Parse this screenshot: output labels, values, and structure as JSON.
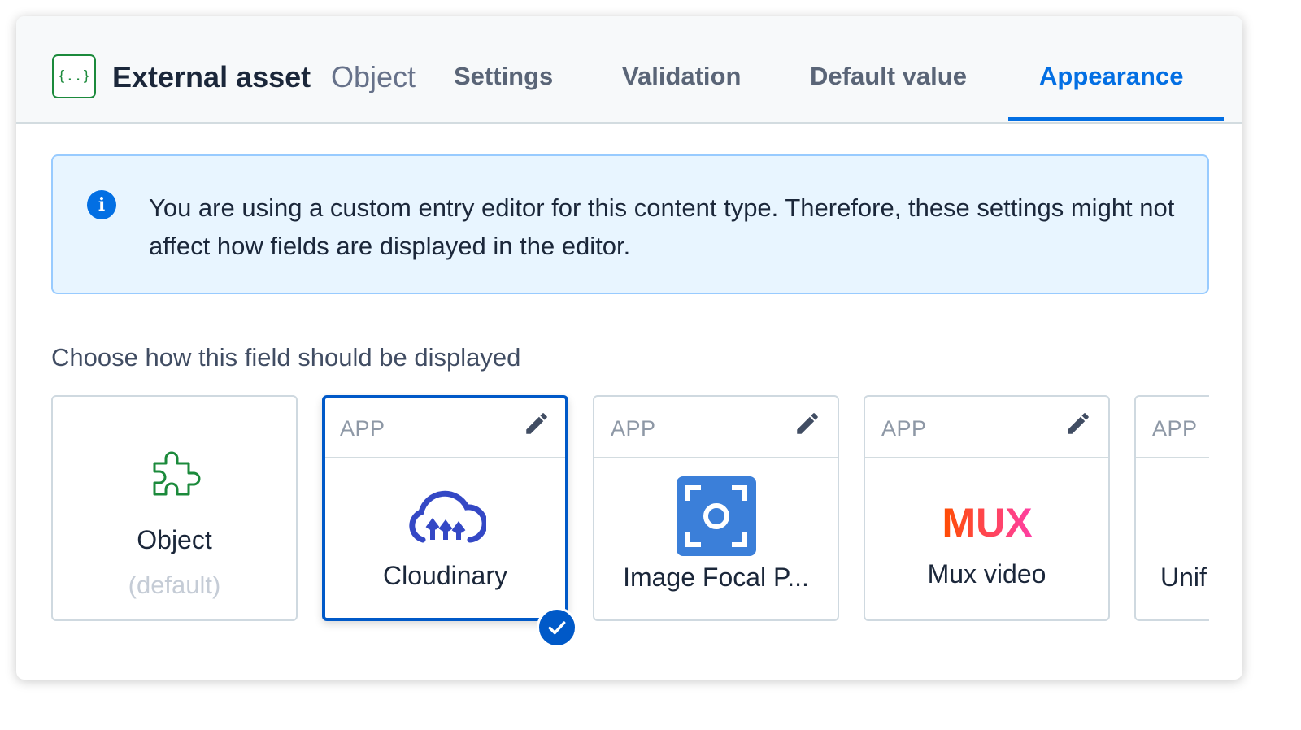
{
  "header": {
    "field_icon_text": "{..}",
    "field_name": "External asset",
    "field_type": "Object",
    "tabs": [
      {
        "label": "Settings",
        "active": false
      },
      {
        "label": "Validation",
        "active": false
      },
      {
        "label": "Default value",
        "active": false
      },
      {
        "label": "Appearance",
        "active": true
      }
    ]
  },
  "note": {
    "icon": "info-icon",
    "text": "You are using a custom entry editor for this content type. Therefore, these settings might not affect how fields are displayed in the editor."
  },
  "section_label": "Choose how this field should be displayed",
  "widgets": [
    {
      "name": "Object",
      "sub": "(default)",
      "icon": "puzzle-icon",
      "selected": false
    },
    {
      "tag": "APP",
      "name": "Cloudinary",
      "icon": "cloudinary-logo",
      "selected": true
    },
    {
      "tag": "APP",
      "name": "Image Focal P...",
      "icon": "focal-point-logo",
      "selected": false
    },
    {
      "tag": "APP",
      "name": "Mux video",
      "icon": "mux-logo",
      "logo_text": "MUX",
      "selected": false
    },
    {
      "tag": "APP",
      "name": "Unif",
      "selected": false
    }
  ],
  "colors": {
    "accent": "#036fe3",
    "selected_border": "#0059c8",
    "note_bg": "#e8f5ff",
    "object_icon": "#1b8a3b",
    "cloudinary": "#3448c5",
    "focal_point": "#3b7fd9",
    "mux_start": "#ff4d00",
    "mux_end": "#ff3ea5"
  }
}
